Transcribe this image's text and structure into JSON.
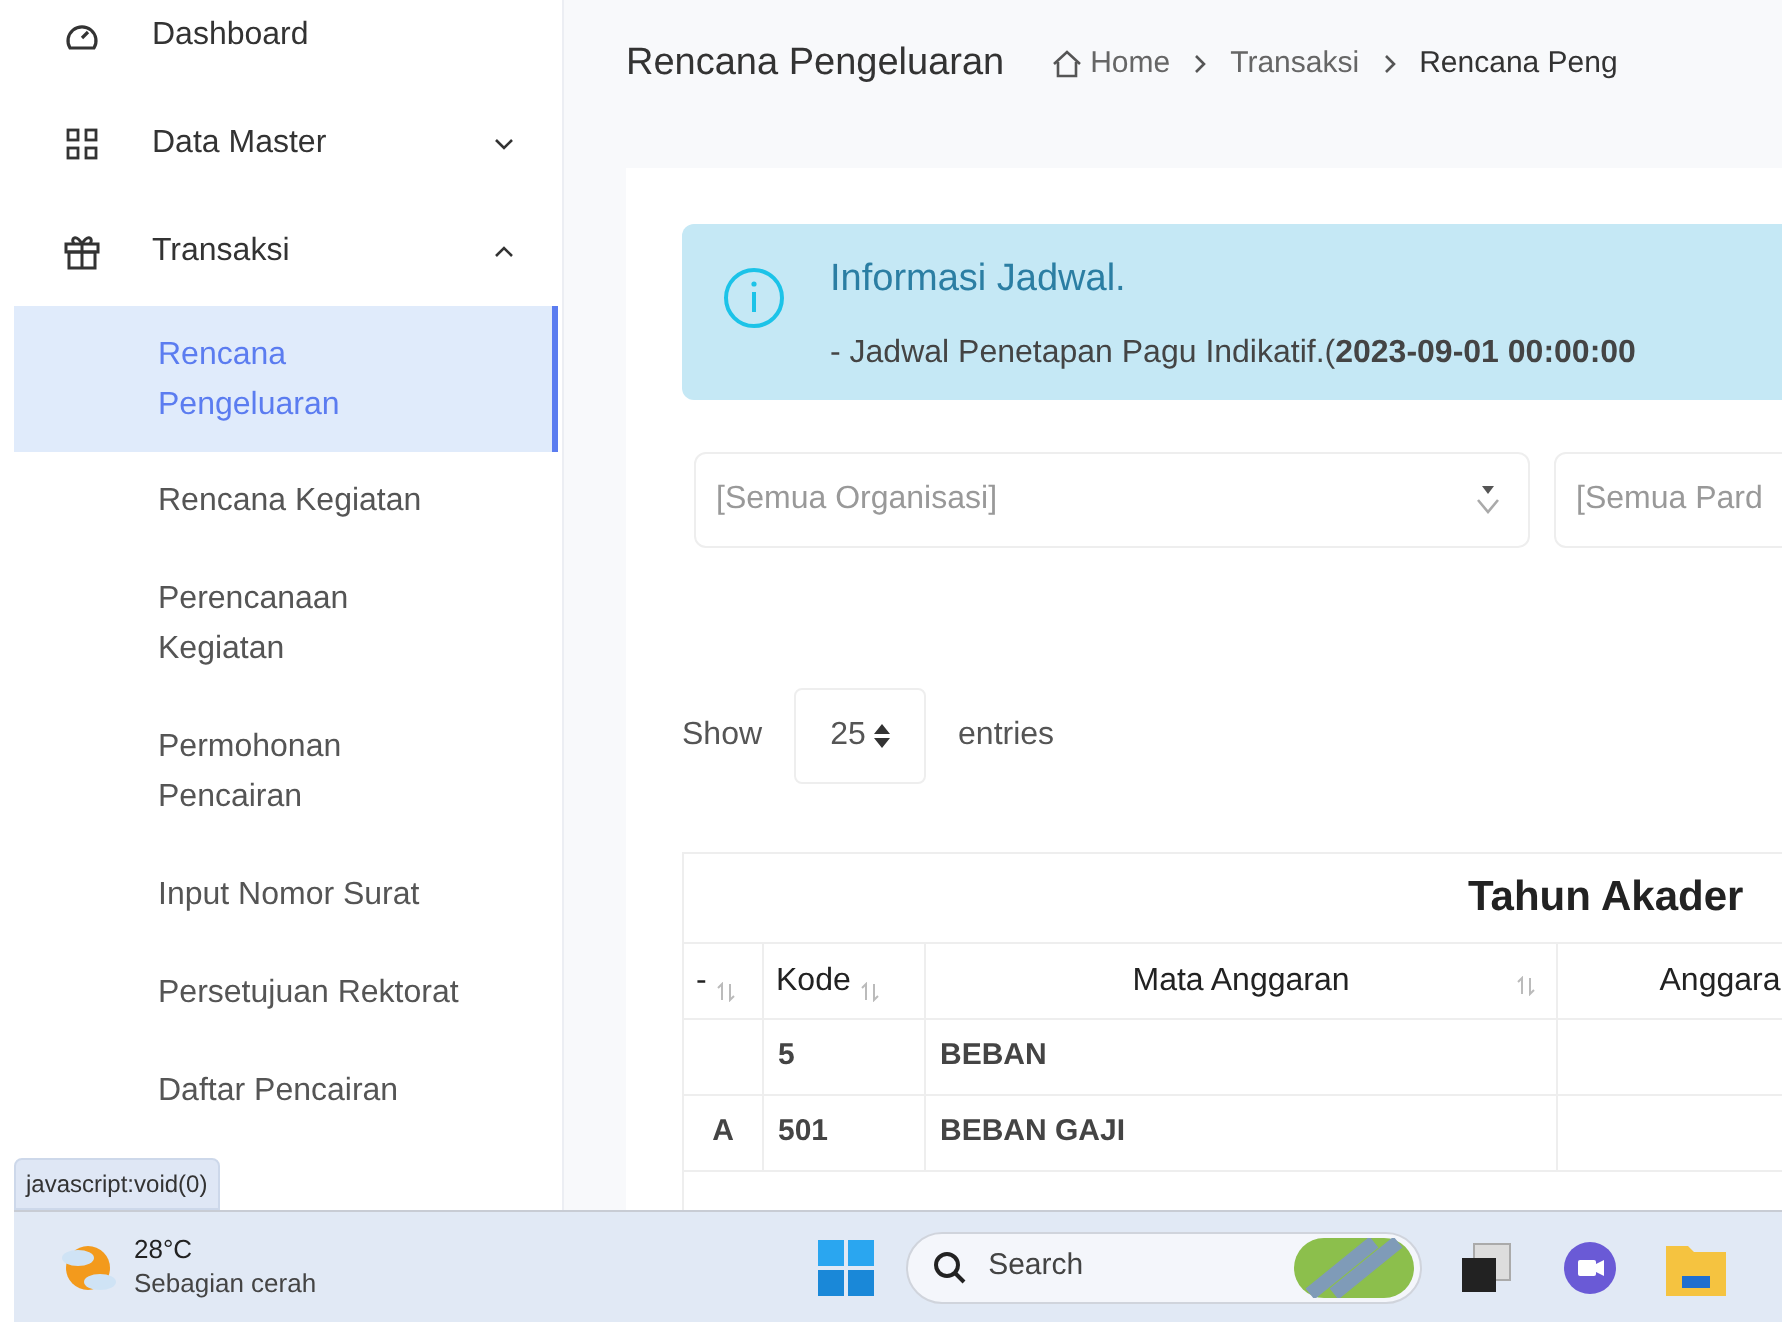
{
  "sidebar": {
    "items": [
      {
        "label": "Dashboard"
      },
      {
        "label": "Data Master",
        "expanded": false
      },
      {
        "label": "Transaksi",
        "expanded": true,
        "children": [
          {
            "label": "Rencana Pengeluaran",
            "selected": true
          },
          {
            "label": "Rencana Kegiatan",
            "selected": false
          },
          {
            "label": "Perencanaan Kegiatan",
            "selected": false
          },
          {
            "label": "Permohonan Pencairan",
            "selected": false
          },
          {
            "label": "Input Nomor Surat",
            "selected": false
          },
          {
            "label": "Persetujuan Rektorat",
            "selected": false
          },
          {
            "label": "Daftar Pencairan",
            "selected": false
          }
        ]
      }
    ]
  },
  "page_title": "Rencana Pengeluaran",
  "breadcrumb": [
    "Home",
    "Transaksi",
    "Rencana Peng"
  ],
  "alert": {
    "title": "Informasi Jadwal.",
    "text": "- Jadwal Penetapan Pagu Indikatif.(**2023-09-01 00:00:00**"
  },
  "filters": [
    {
      "placeholder": "[Semua Organisasi]"
    },
    {
      "placeholder": "[Semua Pard"
    }
  ],
  "length": {
    "show": "Show",
    "value": "25",
    "entries": "entries"
  },
  "table": {
    "title": "Tahun Akader",
    "columns": [
      {
        "label": "-",
        "sortable": true
      },
      {
        "label": "Kode",
        "sortable": true
      },
      {
        "label": "Mata Anggaran",
        "sortable": true
      },
      {
        "label": "Anggara",
        "sortable": false
      }
    ],
    "rows": [
      [
        "",
        "5",
        "BEBAN",
        ""
      ],
      [
        "A",
        "501",
        "BEBAN GAJI",
        ""
      ]
    ]
  },
  "status_tooltip": "javascript:void(0)",
  "taskbar": {
    "temperature": "28°C",
    "weather": "Sebagian cerah",
    "search": "Search"
  }
}
